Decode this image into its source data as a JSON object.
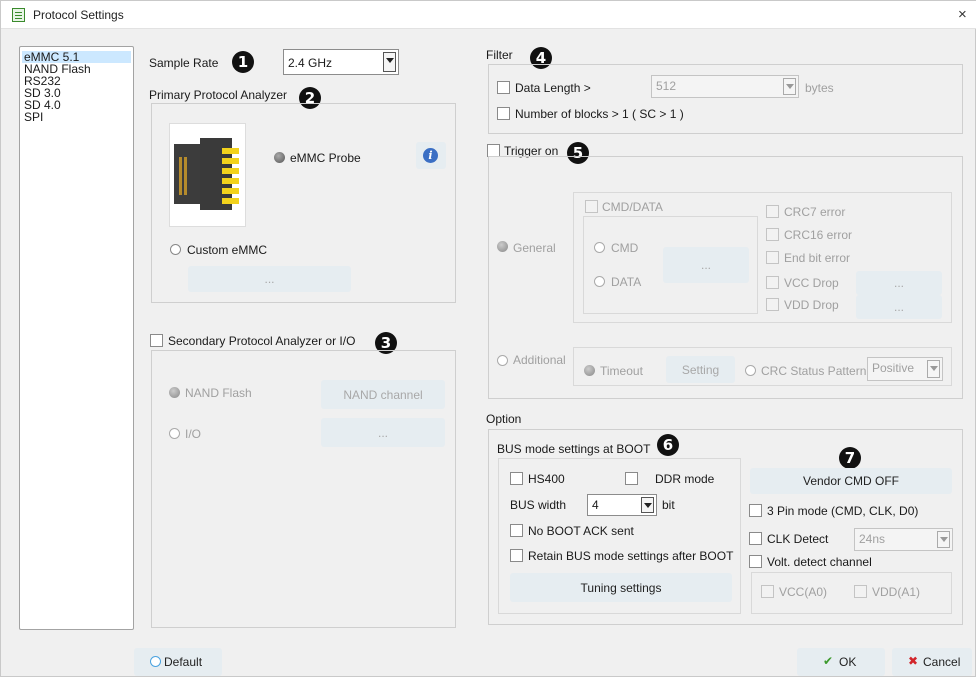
{
  "window": {
    "title": "Protocol Settings",
    "close_glyph": "×"
  },
  "protocols": {
    "items": [
      "eMMC 5.1",
      "NAND Flash",
      "RS232",
      "SD 3.0",
      "SD 4.0",
      "SPI"
    ],
    "selected": "eMMC 5.1"
  },
  "sample_rate": {
    "label": "Sample Rate",
    "value": "2.4 GHz",
    "badge": "1"
  },
  "primary": {
    "title": "Primary Protocol Analyzer",
    "badge": "2",
    "probe_label": "eMMC Probe",
    "info_icon": "i",
    "custom_label": "Custom eMMC",
    "browse_label": "..."
  },
  "secondary": {
    "label": "Secondary Protocol Analyzer or I/O",
    "badge": "3",
    "nand_label": "NAND Flash",
    "nand_button": "NAND channel",
    "io_label": "I/O",
    "io_button": "..."
  },
  "filter": {
    "title": "Filter",
    "badge": "4",
    "data_length_label": "Data Length >",
    "data_length_value": "512",
    "bytes_label": "bytes",
    "blocks_label": "Number of blocks > 1 ( SC > 1 )"
  },
  "trigger": {
    "label": "Trigger on",
    "badge": "5",
    "general_label": "General",
    "cmd_data_label": "CMD/DATA",
    "cmd_label": "CMD",
    "data_label": "DATA",
    "dots": "...",
    "crc7": "CRC7 error",
    "crc16": "CRC16 error",
    "endbit": "End bit error",
    "vcc_drop": "VCC Drop",
    "vdd_drop": "VDD Drop",
    "additional_label": "Additional",
    "timeout_label": "Timeout",
    "setting_button": "Setting",
    "crc_status_label": "CRC Status Pattern",
    "crc_status_value": "Positive"
  },
  "option": {
    "title": "Option",
    "bus_title": "BUS mode settings at BOOT",
    "badge6": "6",
    "hs400": "HS400",
    "ddr": "DDR mode",
    "bus_width_label": "BUS width",
    "bus_width_value": "4",
    "bit_label": "bit",
    "no_boot_ack": "No BOOT ACK sent",
    "retain": "Retain BUS mode settings after BOOT",
    "tuning": "Tuning settings",
    "badge7": "7",
    "vendor": "Vendor CMD OFF",
    "pin3": "3 Pin mode (CMD, CLK, D0)",
    "clk_detect": "CLK Detect",
    "clk_value": "24ns",
    "volt": "Volt. detect channel",
    "vcc": "VCC(A0)",
    "vdd": "VDD(A1)"
  },
  "footer": {
    "default": "Default",
    "ok": "OK",
    "cancel": "Cancel",
    "ok_glyph": "✔",
    "cancel_glyph": "✖"
  },
  "colors": {
    "selection": "#cce8ff",
    "ok_check": "#3c9a2c",
    "cancel_x": "#d2252b",
    "info": "#3b6fc4"
  }
}
